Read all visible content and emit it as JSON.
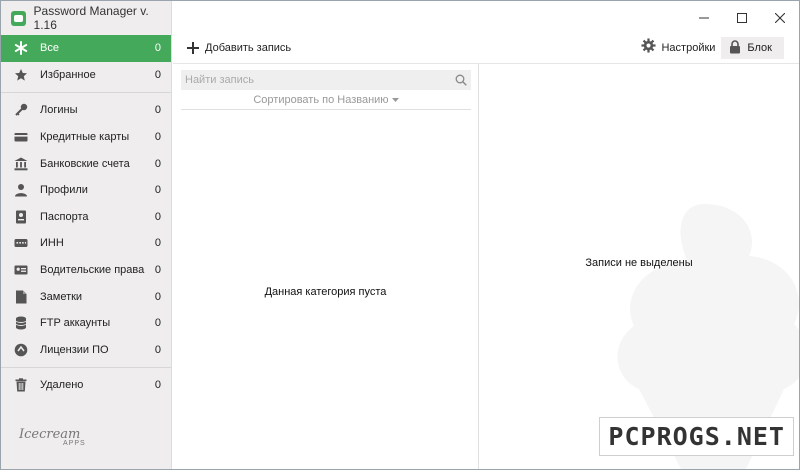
{
  "window": {
    "title": "Password Manager v. 1.16"
  },
  "sidebar": {
    "items": [
      {
        "label": "Все",
        "count": "0",
        "icon": "asterisk-icon"
      },
      {
        "label": "Избранное",
        "count": "0",
        "icon": "star-icon"
      },
      {
        "label": "Логины",
        "count": "0",
        "icon": "key-icon"
      },
      {
        "label": "Кредитные карты",
        "count": "0",
        "icon": "credit-card-icon"
      },
      {
        "label": "Банковские счета",
        "count": "0",
        "icon": "bank-icon"
      },
      {
        "label": "Профили",
        "count": "0",
        "icon": "person-icon"
      },
      {
        "label": "Паспорта",
        "count": "0",
        "icon": "passport-icon"
      },
      {
        "label": "ИНН",
        "count": "0",
        "icon": "keypad-icon"
      },
      {
        "label": "Водительские права",
        "count": "0",
        "icon": "id-card-icon"
      },
      {
        "label": "Заметки",
        "count": "0",
        "icon": "note-icon"
      },
      {
        "label": "FTP аккаунты",
        "count": "0",
        "icon": "database-icon"
      },
      {
        "label": "Лицензии ПО",
        "count": "0",
        "icon": "license-icon"
      },
      {
        "label": "Удалено",
        "count": "0",
        "icon": "trash-icon"
      }
    ],
    "brand": {
      "word": "Icecream",
      "sub": "APPS"
    }
  },
  "toolbar": {
    "add_label": "Добавить запись",
    "settings_label": "Настройки",
    "lock_label": "Блок"
  },
  "list": {
    "search_placeholder": "Найти запись",
    "sort_label": "Сортировать по Названию",
    "empty_text": "Данная категория пуста"
  },
  "detail": {
    "empty_text": "Записи не выделены"
  },
  "watermark": {
    "text": "PCPROGS.NET"
  },
  "colors": {
    "accent": "#45a95b",
    "sidebar_bg": "#efeded"
  }
}
